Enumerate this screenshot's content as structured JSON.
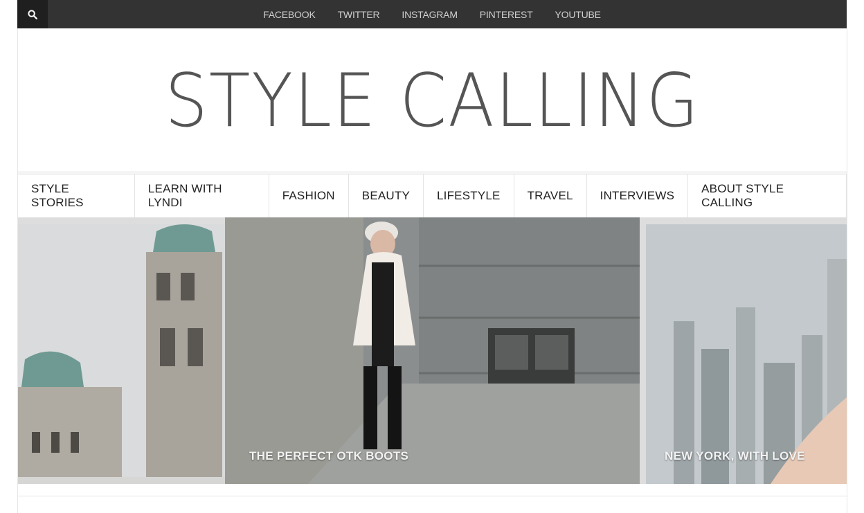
{
  "topbar": {
    "search_icon": "search-icon",
    "social_links": [
      "FACEBOOK",
      "TWITTER",
      "INSTAGRAM",
      "PINTEREST",
      "YOUTUBE"
    ]
  },
  "header": {
    "logo": "STYLE CALLING"
  },
  "nav": {
    "items": [
      "STYLE STORIES",
      "LEARN WITH LYNDI",
      "FASHION",
      "BEAUTY",
      "LIFESTYLE",
      "TRAVEL",
      "INTERVIEWS",
      "ABOUT STYLE CALLING"
    ]
  },
  "slider": {
    "slides": [
      {
        "caption": ""
      },
      {
        "caption": "THE PERFECT OTK BOOTS"
      },
      {
        "caption": "NEW YORK, WITH LOVE"
      }
    ]
  },
  "colors": {
    "topbar_bg": "#333333",
    "logo": "#555555",
    "nav_text": "#222222"
  }
}
